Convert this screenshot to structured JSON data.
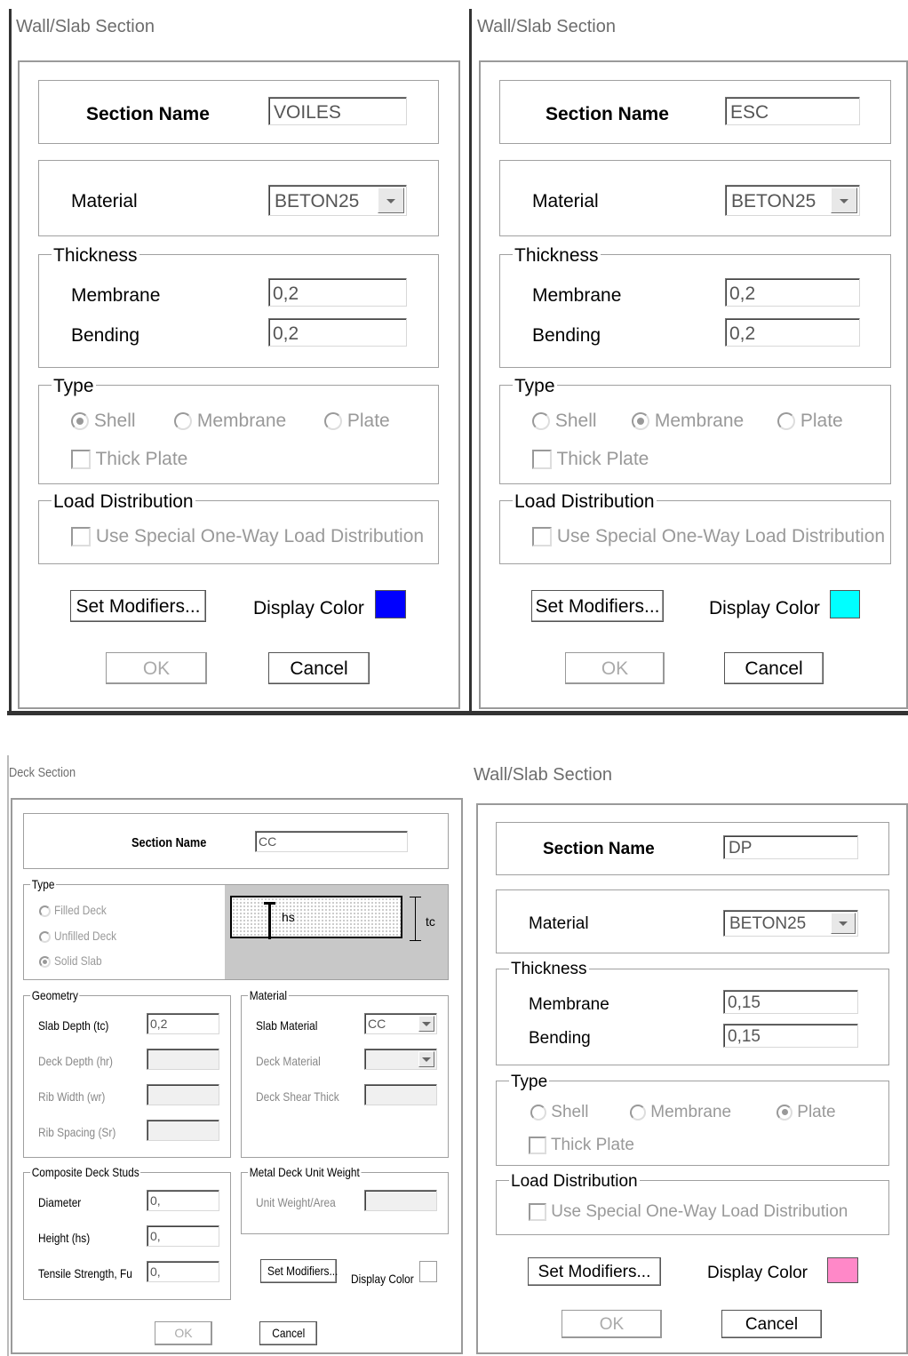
{
  "d1": {
    "title": "Wall/Slab Section",
    "section_name_label": "Section Name",
    "section_name": "VOILES",
    "material_label": "Material",
    "material": "BETON25",
    "thickness_legend": "Thickness",
    "membrane_label": "Membrane",
    "membrane": "0,2",
    "bending_label": "Bending",
    "bending": "0,2",
    "type_legend": "Type",
    "shell": "Shell",
    "membrane_opt": "Membrane",
    "plate": "Plate",
    "selected_type": "Shell",
    "thick_plate": "Thick Plate",
    "load_legend": "Load Distribution",
    "load_option": "Use Special One-Way Load Distribution",
    "set_modifiers": "Set Modifiers...",
    "display_color_label": "Display Color",
    "display_color": "#0000ff",
    "ok": "OK",
    "cancel": "Cancel"
  },
  "d2": {
    "title": "Wall/Slab Section",
    "section_name_label": "Section Name",
    "section_name": "ESC",
    "material_label": "Material",
    "material": "BETON25",
    "thickness_legend": "Thickness",
    "membrane_label": "Membrane",
    "membrane": "0,2",
    "bending_label": "Bending",
    "bending": "0,2",
    "type_legend": "Type",
    "shell": "Shell",
    "membrane_opt": "Membrane",
    "plate": "Plate",
    "selected_type": "Membrane",
    "thick_plate": "Thick Plate",
    "load_legend": "Load Distribution",
    "load_option": "Use Special One-Way Load Distribution",
    "set_modifiers": "Set Modifiers...",
    "display_color_label": "Display Color",
    "display_color": "#00ffff",
    "ok": "OK",
    "cancel": "Cancel"
  },
  "d3": {
    "title": "Deck Section",
    "section_name_label": "Section Name",
    "section_name": "CC",
    "type_legend": "Type",
    "filled_deck": "Filled Deck",
    "unfilled_deck": "Unfilled Deck",
    "solid_slab": "Solid Slab",
    "selected_type": "Solid Slab",
    "diagram_hs": "hs",
    "diagram_tc": "tc",
    "geometry_legend": "Geometry",
    "slab_depth_label": "Slab Depth (tc)",
    "slab_depth": "0,2",
    "deck_depth_label": "Deck Depth (hr)",
    "rib_width_label": "Rib Width (wr)",
    "rib_spacing_label": "Rib Spacing (Sr)",
    "material_legend": "Material",
    "slab_material_label": "Slab Material",
    "slab_material": "CC",
    "deck_material_label": "Deck Material",
    "deck_shear_label": "Deck Shear Thick",
    "studs_legend": "Composite Deck Studs",
    "diameter_label": "Diameter",
    "diameter": "0,",
    "height_label": "Height (hs)",
    "height": "0,",
    "tensile_label": "Tensile Strength, Fu",
    "tensile": "0,",
    "unit_weight_legend": "Metal Deck Unit Weight",
    "unit_weight_label": "Unit Weight/Area",
    "set_modifiers": "Set Modifiers...",
    "display_color_label": "Display Color",
    "display_color": "#ffffff",
    "ok": "OK",
    "cancel": "Cancel"
  },
  "d4": {
    "title": "Wall/Slab Section",
    "section_name_label": "Section Name",
    "section_name": "DP",
    "material_label": "Material",
    "material": "BETON25",
    "thickness_legend": "Thickness",
    "membrane_label": "Membrane",
    "membrane": "0,15",
    "bending_label": "Bending",
    "bending": "0,15",
    "type_legend": "Type",
    "shell": "Shell",
    "membrane_opt": "Membrane",
    "plate": "Plate",
    "selected_type": "Plate",
    "thick_plate": "Thick Plate",
    "load_legend": "Load Distribution",
    "load_option": "Use Special One-Way Load Distribution",
    "set_modifiers": "Set Modifiers...",
    "display_color_label": "Display Color",
    "display_color": "#ff88c8",
    "ok": "OK",
    "cancel": "Cancel"
  }
}
